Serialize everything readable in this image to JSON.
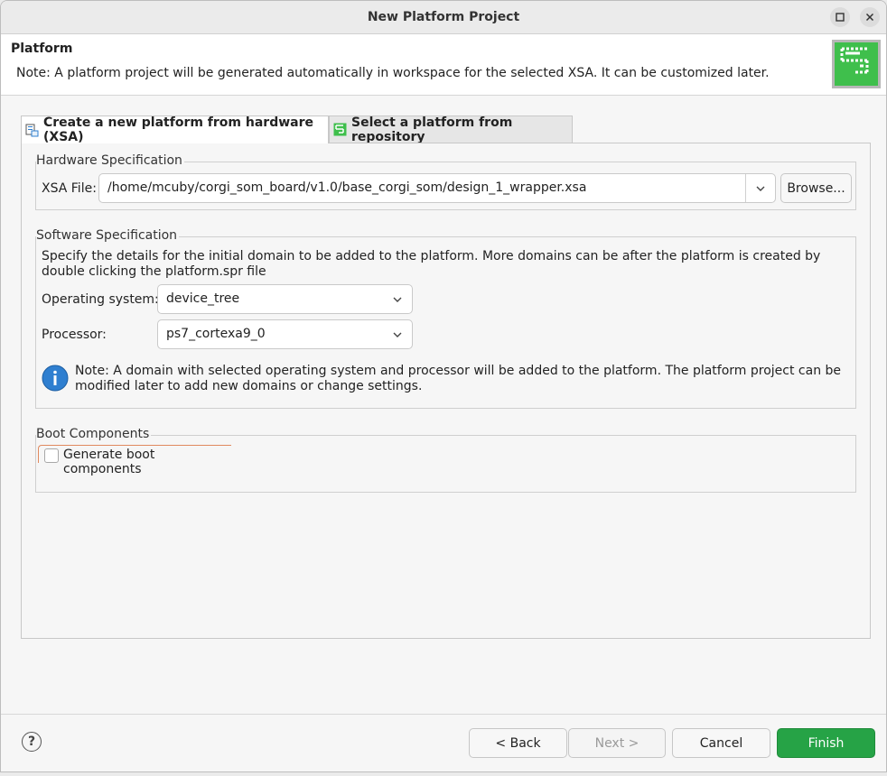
{
  "window": {
    "title": "New Platform Project"
  },
  "header": {
    "title": "Platform",
    "note": "Note: A platform project will be generated automatically in workspace for the selected XSA. It can be customized later.",
    "logo_icon": "platform-wizard-logo"
  },
  "tabs": [
    {
      "label": "Create a new platform from hardware (XSA)",
      "icon": "xsa-hardware-icon",
      "active": true
    },
    {
      "label": "Select a platform from repository",
      "icon": "repository-icon",
      "active": false
    }
  ],
  "hardware": {
    "group_label": "Hardware Specification",
    "xsa_label": "XSA File:",
    "xsa_value": "/home/mcuby/corgi_som_board/v1.0/base_corgi_som/design_1_wrapper.xsa",
    "browse_label": "Browse..."
  },
  "software": {
    "group_label": "Software Specification",
    "description": "Specify the details for the initial domain to be added to the platform. More domains can be after the platform is created by double clicking the platform.spr file",
    "os_label": "Operating system:",
    "os_value": "device_tree",
    "processor_label": "Processor:",
    "processor_value": "ps7_cortexa9_0",
    "info_note": "Note: A domain with selected operating system and processor will be added to the platform. The platform project can be modified later to add new domains or change settings."
  },
  "boot": {
    "group_label": "Boot Components",
    "checkbox_label": "Generate boot components",
    "checked": false
  },
  "footer": {
    "help_glyph": "?",
    "back_label": "< Back",
    "next_label": "Next >",
    "cancel_label": "Cancel",
    "finish_label": "Finish"
  },
  "colors": {
    "accent": "#26a346",
    "info": "#2f7fd0"
  }
}
